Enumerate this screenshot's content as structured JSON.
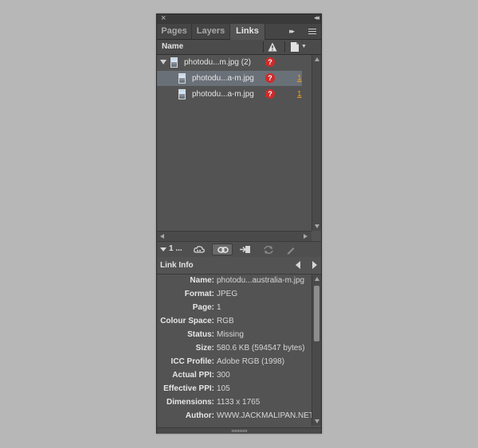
{
  "titlebar": {
    "close_glyph": "×",
    "collapse_glyph": "◂◂"
  },
  "tabs": [
    {
      "label": "Pages",
      "active": false
    },
    {
      "label": "Layers",
      "active": false
    },
    {
      "label": "Links",
      "active": true
    }
  ],
  "tab_extras": {
    "forward_glyph": "▸▸"
  },
  "columns": {
    "name": "Name",
    "status_icon": "warning-icon",
    "page_icon": "page-icon"
  },
  "links": [
    {
      "label": "photodu...m.jpg (2)",
      "kind": "group",
      "status": "?",
      "page": "",
      "selected": false
    },
    {
      "label": "photodu...a-m.jpg",
      "kind": "child",
      "status": "?",
      "page": "1",
      "selected": true
    },
    {
      "label": "photodu...a-m.jpg",
      "kind": "child",
      "status": "?",
      "page": "1",
      "selected": false
    }
  ],
  "toolbar": {
    "count": "1 ..."
  },
  "link_info": {
    "title": "Link Info",
    "fields": [
      {
        "key": "Name:",
        "value": "photodu...australia-m.jpg"
      },
      {
        "key": "Format:",
        "value": "JPEG"
      },
      {
        "key": "Page:",
        "value": "1"
      },
      {
        "key": "Colour Space:",
        "value": "RGB"
      },
      {
        "key": "Status:",
        "value": "Missing"
      },
      {
        "key": "Size:",
        "value": "580.6 KB (594547 bytes)"
      },
      {
        "key": "ICC Profile:",
        "value": "Adobe RGB (1998)"
      },
      {
        "key": "Actual PPI:",
        "value": "300"
      },
      {
        "key": "Effective PPI:",
        "value": "105"
      },
      {
        "key": "Dimensions:",
        "value": "1133 x 1765"
      },
      {
        "key": "Author:",
        "value": "WWW.JACKMALIPAN.NET"
      }
    ]
  },
  "colors": {
    "panel_bg": "#535353",
    "selection": "#6a7078",
    "missing_badge": "#d02a2a",
    "page_link": "#f0a020"
  }
}
